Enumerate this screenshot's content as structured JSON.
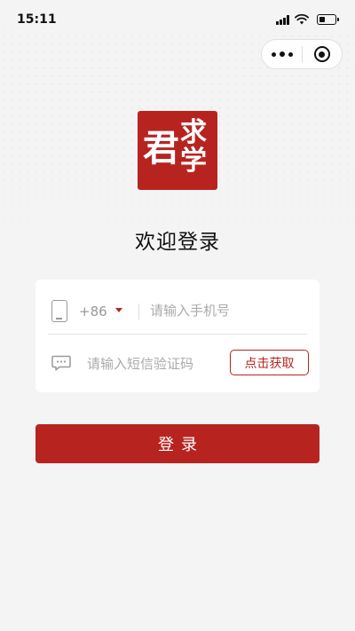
{
  "status_bar": {
    "time": "15:11",
    "icons": [
      "signal-icon",
      "wifi-icon",
      "battery-icon"
    ]
  },
  "capsule": {
    "more_icon": "more-dots-icon",
    "close_icon": "close-circle-icon"
  },
  "logo": {
    "char_main": "君",
    "char_top": "求",
    "char_bottom": "学"
  },
  "title": "欢迎登录",
  "form": {
    "country_code": "+86",
    "phone_placeholder": "请输入手机号",
    "code_placeholder": "请输入短信验证码",
    "get_code_label": "点击获取",
    "phone_icon": "phone-icon",
    "message_icon": "message-icon",
    "dropdown_icon": "caret-down-icon"
  },
  "login_button": "登录",
  "colors": {
    "accent": "#b72420",
    "background": "#f4f4f4",
    "card": "#ffffff",
    "placeholder": "#aaaaaa"
  }
}
